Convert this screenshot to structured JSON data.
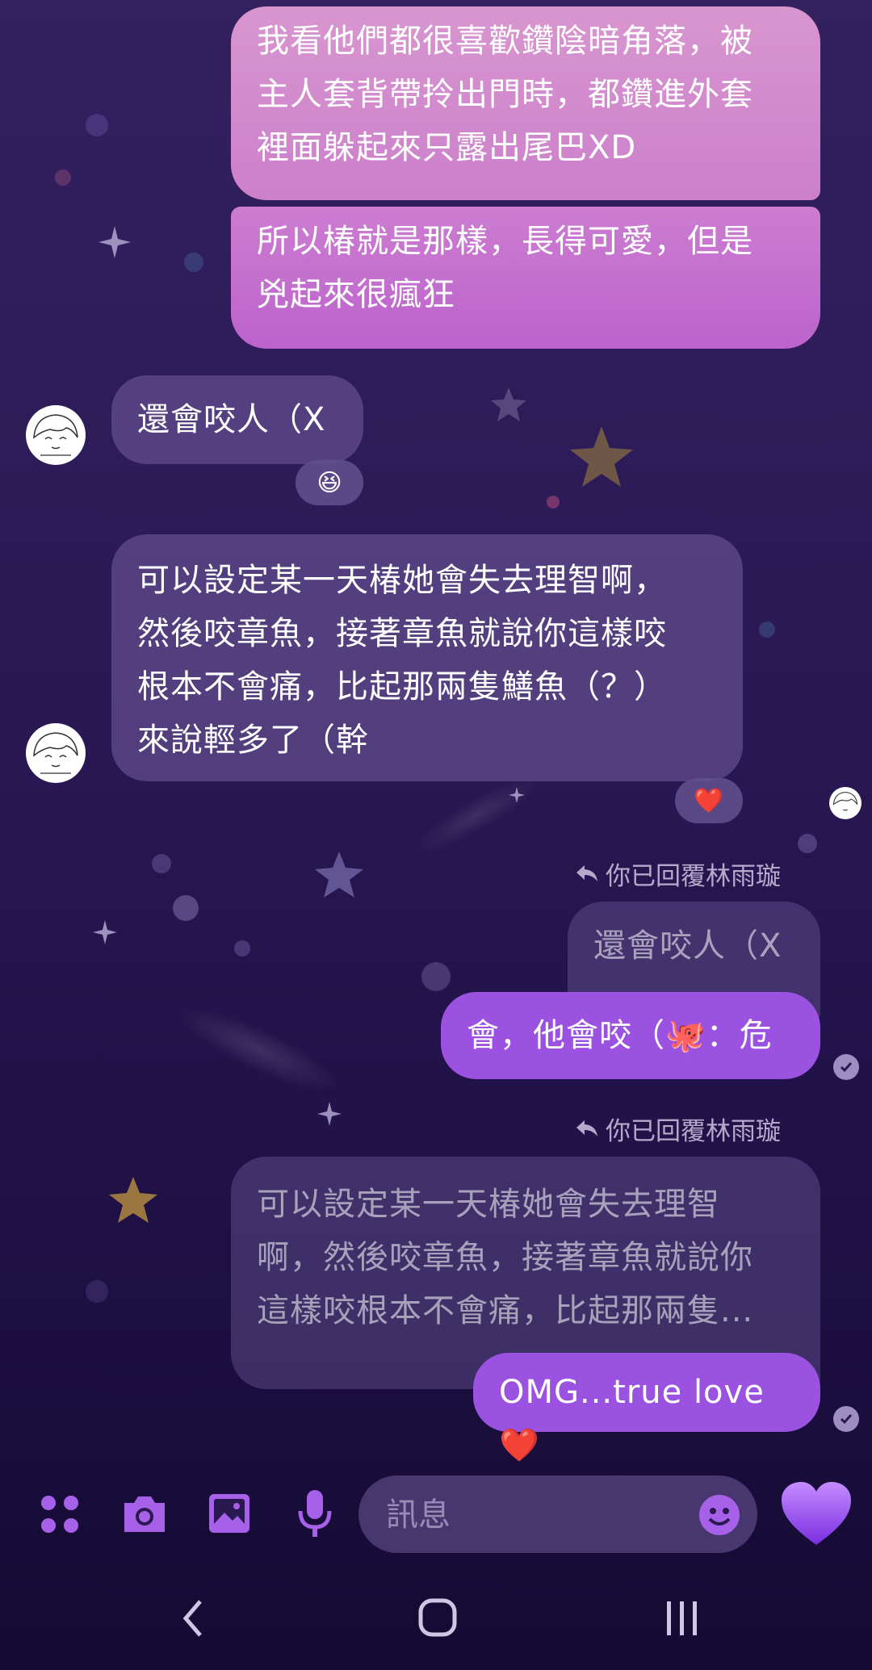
{
  "messages": {
    "out_1": {
      "lines": [
        "我看他們都很喜歡鑽陰暗角落，被",
        "主人套背帶拎出門時，都鑽進外套",
        "裡面躲起來只露出尾巴XD"
      ]
    },
    "out_2": {
      "lines": [
        "所以椿就是那樣，長得可愛，但是",
        "兇起來很瘋狂"
      ]
    },
    "in_1": {
      "text": "還會咬人（X",
      "reaction_emoji": "😆"
    },
    "in_2": {
      "lines": [
        "可以設定某一天椿她會失去理智啊，",
        "然後咬章魚，接著章魚就說你這樣咬",
        "根本不會痛，比起那兩隻鱔魚（？）",
        "來說輕多了（幹"
      ],
      "reaction_emoji": "❤️"
    },
    "reply_1": {
      "label": "你已回覆林雨璇",
      "quoted": "還會咬人（X",
      "text": "會，他會咬（🐙：危"
    },
    "reply_2": {
      "label": "你已回覆林雨璇",
      "quoted_lines": [
        "可以設定某一天椿她會失去理智",
        "啊，然後咬章魚，接著章魚就說你",
        "這樣咬根本不會痛，比起那兩隻..."
      ],
      "text": "OMG...true love❤️"
    }
  },
  "composer": {
    "placeholder": "訊息",
    "icons": [
      "apps-icon",
      "camera-icon",
      "gallery-icon",
      "microphone-icon",
      "emoji-icon",
      "heart-icon"
    ]
  },
  "nav": {
    "icons": [
      "back-icon",
      "home-icon",
      "recents-icon"
    ]
  },
  "colors": {
    "accent": "#9b52e0",
    "outgoing": "#cc80cb",
    "incoming": "#5e4a8a"
  }
}
